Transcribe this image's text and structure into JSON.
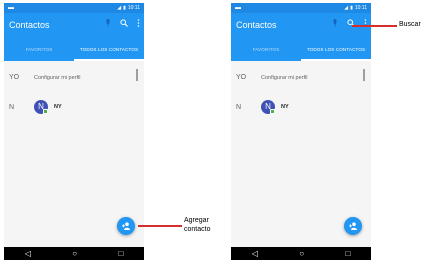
{
  "phones": [
    {
      "status": {
        "left": "▬",
        "right": "10:11"
      },
      "appbar": {
        "title": "Contactos",
        "mic_icon": "microphone-icon",
        "search_icon": "search-icon",
        "more_icon": "more-vert-icon"
      },
      "tabs": [
        {
          "label": "FAVORITOS"
        },
        {
          "label": "TODOS LOS CONTACTOS"
        }
      ],
      "section_me": "YO",
      "profile_label": "Configurar mi perfil",
      "section_n": "N",
      "contact": {
        "initial": "N",
        "name": "NY"
      },
      "fab_icon": "add-contact-icon",
      "nav": {
        "back": "◁",
        "home": "○",
        "recents": "□"
      }
    },
    {
      "status": {
        "left": "▬",
        "right": "10:11"
      },
      "appbar": {
        "title": "Contactos",
        "mic_icon": "microphone-icon",
        "search_icon": "search-icon",
        "more_icon": "more-vert-icon"
      },
      "tabs": [
        {
          "label": "FAVORITOS"
        },
        {
          "label": "TODOS LOS CONTACTOS"
        }
      ],
      "section_me": "YO",
      "profile_label": "Configurar mi perfil",
      "section_n": "N",
      "contact": {
        "initial": "N",
        "name": "NY"
      },
      "fab_icon": "add-contact-icon",
      "nav": {
        "back": "◁",
        "home": "○",
        "recents": "□"
      }
    }
  ],
  "callouts": {
    "buscar": "Buscar",
    "agregar_line1": "Agregar",
    "agregar_line2": "contacto"
  },
  "colors": {
    "primary": "#2196f3",
    "status": "#1e88e5",
    "callout": "#d32f2f"
  }
}
